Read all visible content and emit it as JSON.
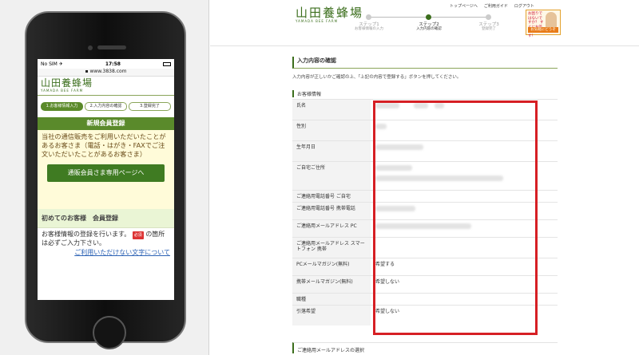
{
  "mobile": {
    "status_carrier": "No SIM ✈",
    "status_time": "17:58",
    "url": "www.3838.com",
    "logo_main": "山田養蜂場",
    "logo_sub": "YAMADA BEE FARM",
    "steps": [
      "1.お客様情報入力",
      "2.入力内容の確認",
      "3.登録完了"
    ],
    "section_title": "新規会員登録",
    "notice": "当社の通信販売をご利用いただいたことがあるお客さま（電話・はがき・FAXでご注文いただいたことがあるお客さま）",
    "members_button": "通販会員さま専用ページへ",
    "first_time_title": "初めてのお客様　会員登録",
    "registration_text_1": "お客様情報の登録を行います。",
    "required_badge": "必須",
    "registration_text_2": "の箇所は必ずご入力下さい。",
    "unusable_chars_link": "ご利用いただけない文字について"
  },
  "pc": {
    "logo_main": "山田養蜂場",
    "logo_sub": "YAMADA BEE FARM",
    "nav": [
      "トップページへ",
      "ご利用ガイド",
      "ログアウト"
    ],
    "steps": [
      {
        "label": "ステップ1",
        "sub": "お客様情報の入力"
      },
      {
        "label": "ステップ2",
        "sub": "入力内容の確認"
      },
      {
        "label": "ステップ3",
        "sub": "登録完了"
      }
    ],
    "banner_text": "お困りではないですか？ すぐにお答えします！",
    "banner_button": "お気軽にどうぞ",
    "section_title": "入力内容の確認",
    "intro": "入力内容が正しいかご確認の上、「上記の内容で登録する」ボタンを押してください。",
    "customer_info_title": "お客様情報",
    "rows": [
      {
        "label": "氏名",
        "value": ""
      },
      {
        "label": "性別",
        "value": ""
      },
      {
        "label": "生年月日",
        "value": ""
      },
      {
        "label": "ご自宅ご住所",
        "value": ""
      },
      {
        "label": "ご連絡用電話番号 ご自宅",
        "value": ""
      },
      {
        "label": "ご連絡用電話番号 携帯電話",
        "value": ""
      },
      {
        "label": "ご連絡用メールアドレス PC",
        "value": ""
      },
      {
        "label": "ご連絡用メールアドレス スマートフォン 携帯",
        "value": ""
      },
      {
        "label": "PCメールマガジン(無料)",
        "value": "希望する"
      },
      {
        "label": "携帯メールマガジン(無料)",
        "value": "希望しない"
      },
      {
        "label": "職種",
        "value": ""
      },
      {
        "label": "引落希望",
        "value": "希望しない"
      }
    ],
    "bottom_section_title": "ご連絡用メールアドレスの選択"
  },
  "colors": {
    "brand_green": "#3b6e1c",
    "highlight_red": "#d61f24",
    "notice_bg": "#fffbd9"
  }
}
